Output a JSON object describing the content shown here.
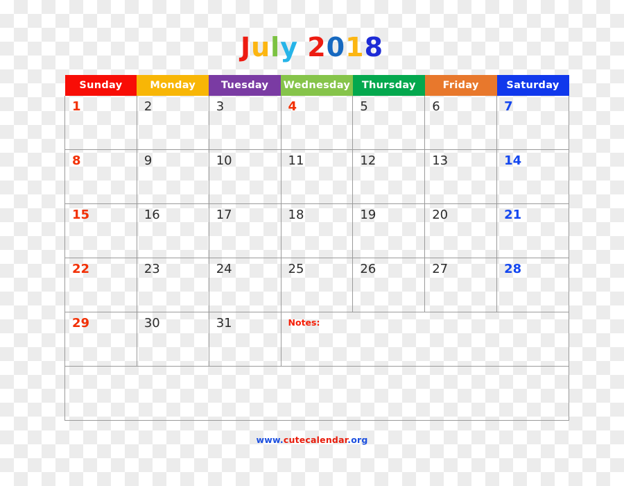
{
  "title": {
    "text": "July 2018",
    "parts": [
      {
        "ch": "J",
        "color": "#ed1c12"
      },
      {
        "ch": "u",
        "color": "#fcb612"
      },
      {
        "ch": "l",
        "color": "#7cc242"
      },
      {
        "ch": "y",
        "color": "#26b4e8"
      },
      {
        "ch": " ",
        "color": "#000000"
      },
      {
        "ch": "2",
        "color": "#ed1c12"
      },
      {
        "ch": "0",
        "color": "#1769c0"
      },
      {
        "ch": "1",
        "color": "#fcb612"
      },
      {
        "ch": "8",
        "color": "#1d2bd6"
      }
    ]
  },
  "weekdays": [
    {
      "label": "Sunday",
      "color": "#f80d06"
    },
    {
      "label": "Monday",
      "color": "#f8b606"
    },
    {
      "label": "Tuesday",
      "color": "#7a3ba3"
    },
    {
      "label": "Wednesday",
      "color": "#86c44a"
    },
    {
      "label": "Thursday",
      "color": "#04a84e"
    },
    {
      "label": "Friday",
      "color": "#e8782c"
    },
    {
      "label": "Saturday",
      "color": "#1038ec"
    }
  ],
  "weeks": [
    [
      {
        "day": "1",
        "kind": "sun"
      },
      {
        "day": "2",
        "kind": "wd"
      },
      {
        "day": "3",
        "kind": "wd"
      },
      {
        "day": "4",
        "kind": "hol"
      },
      {
        "day": "5",
        "kind": "wd"
      },
      {
        "day": "6",
        "kind": "wd"
      },
      {
        "day": "7",
        "kind": "sat"
      }
    ],
    [
      {
        "day": "8",
        "kind": "sun"
      },
      {
        "day": "9",
        "kind": "wd"
      },
      {
        "day": "10",
        "kind": "wd"
      },
      {
        "day": "11",
        "kind": "wd"
      },
      {
        "day": "12",
        "kind": "wd"
      },
      {
        "day": "13",
        "kind": "wd"
      },
      {
        "day": "14",
        "kind": "sat"
      }
    ],
    [
      {
        "day": "15",
        "kind": "sun"
      },
      {
        "day": "16",
        "kind": "wd"
      },
      {
        "day": "17",
        "kind": "wd"
      },
      {
        "day": "18",
        "kind": "wd"
      },
      {
        "day": "19",
        "kind": "wd"
      },
      {
        "day": "20",
        "kind": "wd"
      },
      {
        "day": "21",
        "kind": "sat"
      }
    ],
    [
      {
        "day": "22",
        "kind": "sun"
      },
      {
        "day": "23",
        "kind": "wd"
      },
      {
        "day": "24",
        "kind": "wd"
      },
      {
        "day": "25",
        "kind": "wd"
      },
      {
        "day": "26",
        "kind": "wd"
      },
      {
        "day": "27",
        "kind": "wd"
      },
      {
        "day": "28",
        "kind": "sat"
      }
    ]
  ],
  "last_week": [
    {
      "day": "29",
      "kind": "sun"
    },
    {
      "day": "30",
      "kind": "wd"
    },
    {
      "day": "31",
      "kind": "wd"
    }
  ],
  "notes": {
    "label": "Notes:",
    "color": "#f51e06"
  },
  "footer": {
    "full": "www.cutecalendar.org",
    "part1": "www.",
    "part2": "cutecalendar",
    "part3": ".org"
  }
}
